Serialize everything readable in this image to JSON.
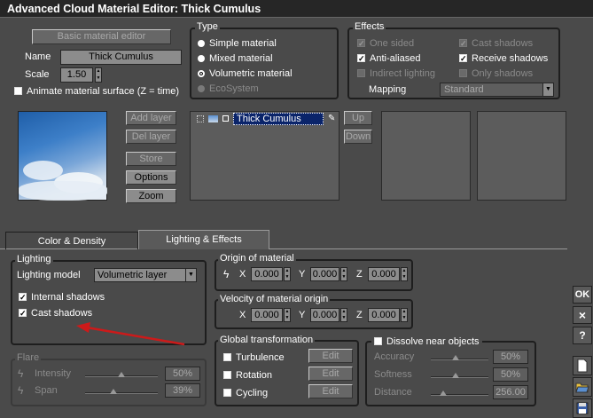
{
  "window": {
    "title": "Advanced Cloud Material Editor: Thick Cumulus"
  },
  "top": {
    "basic_editor_label": "Basic material editor",
    "name_label": "Name",
    "name_value": "Thick Cumulus",
    "scale_label": "Scale",
    "scale_value": "1.50",
    "animate_label": "Animate material surface (Z = time)"
  },
  "type": {
    "title": "Type",
    "options": [
      "Simple material",
      "Mixed material",
      "Volumetric material",
      "EcoSystem"
    ],
    "selected": "Volumetric material"
  },
  "effects": {
    "title": "Effects",
    "one_sided": "One sided",
    "cast_shadows": "Cast shadows",
    "anti_aliased": "Anti-aliased",
    "receive_shadows": "Receive shadows",
    "indirect_lighting": "Indirect lighting",
    "only_shadows": "Only shadows",
    "mapping_label": "Mapping",
    "mapping_value": "Standard"
  },
  "layers": {
    "add": "Add layer",
    "del": "Del layer",
    "store": "Store",
    "options": "Options",
    "zoom": "Zoom",
    "items": [
      "Thick Cumulus"
    ],
    "up": "Up",
    "down": "Down"
  },
  "tabs": [
    "Color & Density",
    "Lighting & Effects"
  ],
  "active_tab": "Lighting & Effects",
  "lighting": {
    "title": "Lighting",
    "model_label": "Lighting model",
    "model_value": "Volumetric layer",
    "internal_shadows": "Internal shadows",
    "cast_shadows": "Cast shadows"
  },
  "origin": {
    "title": "Origin of material",
    "x": "0.000",
    "y": "0.000",
    "z": "0.000"
  },
  "velocity": {
    "title": "Velocity of material origin",
    "x": "0.000",
    "y": "0.000",
    "z": "0.000"
  },
  "axes": {
    "x": "X",
    "y": "Y",
    "z": "Z"
  },
  "flare": {
    "title": "Flare",
    "intensity_label": "Intensity",
    "intensity_value": "50%",
    "span_label": "Span",
    "span_value": "39%",
    "intensity_level": 0.5,
    "span_level": 0.39
  },
  "global": {
    "title": "Global transformation",
    "turbulence": "Turbulence",
    "rotation": "Rotation",
    "cycling": "Cycling",
    "edit": "Edit"
  },
  "dissolve": {
    "title": "Dissolve near objects",
    "accuracy_label": "Accuracy",
    "accuracy_value": "50%",
    "softness_label": "Softness",
    "softness_value": "50%",
    "distance_label": "Distance",
    "distance_value": "256.00"
  },
  "side": {
    "ok": "OK",
    "close": "×",
    "help": "?"
  },
  "colors": {
    "arrow": "#cc1a1a",
    "selection": "#0a246a"
  }
}
